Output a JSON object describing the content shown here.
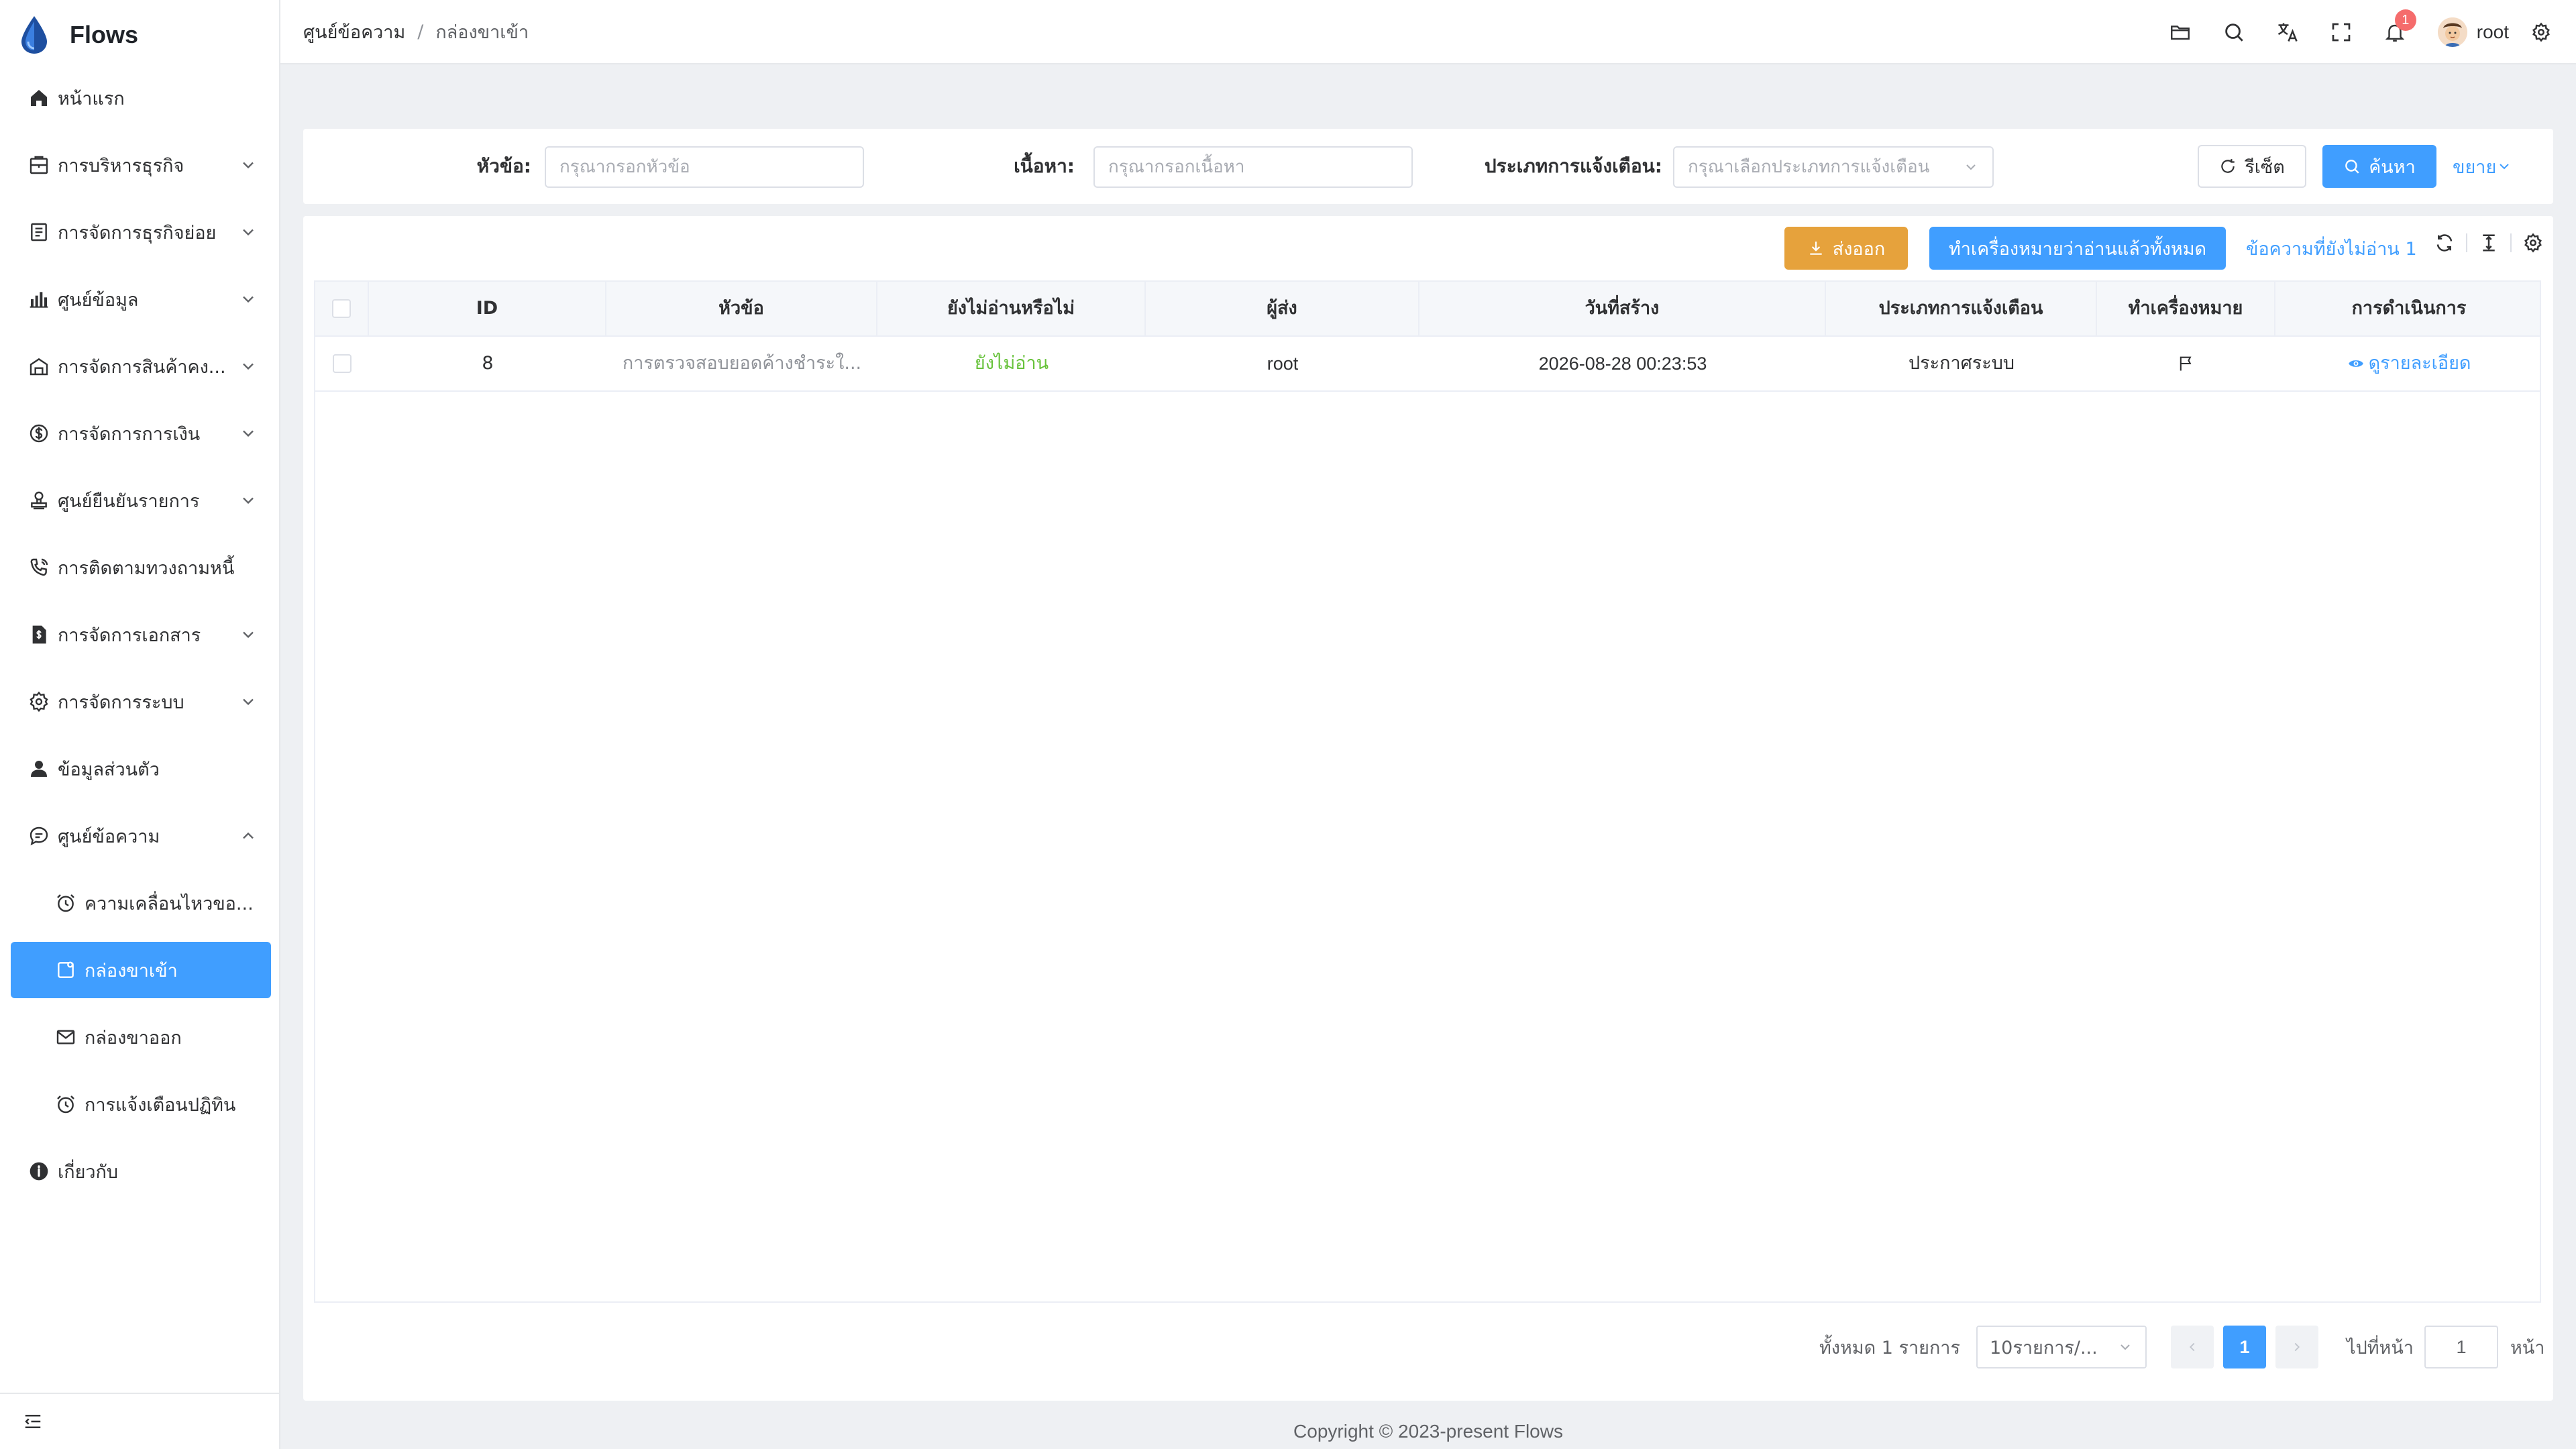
{
  "app": {
    "name": "Flows"
  },
  "sidebar": {
    "items": [
      {
        "label": "หน้าแรก",
        "icon": "home-icon",
        "has_arrow": false
      },
      {
        "label": "การบริหารธุรกิจ",
        "icon": "briefcase-icon",
        "has_arrow": true
      },
      {
        "label": "การจัดการธุรกิจย่อย",
        "icon": "document-list-icon",
        "has_arrow": true
      },
      {
        "label": "ศูนย์ข้อมูล",
        "icon": "bar-chart-icon",
        "has_arrow": true
      },
      {
        "label": "การจัดการสินค้าคง...",
        "icon": "warehouse-icon",
        "has_arrow": true
      },
      {
        "label": "การจัดการการเงิน",
        "icon": "money-icon",
        "has_arrow": true
      },
      {
        "label": "ศูนย์ยืนยันรายการ",
        "icon": "stamp-icon",
        "has_arrow": true
      },
      {
        "label": "การติดตามทวงถามหนี้",
        "icon": "phone-call-icon",
        "has_arrow": false
      },
      {
        "label": "การจัดการเอกสาร",
        "icon": "file-dollar-icon",
        "has_arrow": true
      },
      {
        "label": "การจัดการระบบ",
        "icon": "gear-icon",
        "has_arrow": true
      },
      {
        "label": "ข้อมูลส่วนตัว",
        "icon": "user-icon",
        "has_arrow": false
      },
      {
        "label": "ศูนย์ข้อความ",
        "icon": "chat-icon",
        "has_arrow": true,
        "expanded": true
      }
    ],
    "sub_items": [
      {
        "label": "ความเคลื่อนไหวขอ...",
        "icon": "alarm-clock-icon"
      },
      {
        "label": "กล่องขาเข้า",
        "icon": "inbox-icon",
        "active": true
      },
      {
        "label": "กล่องขาออก",
        "icon": "envelope-icon"
      },
      {
        "label": "การแจ้งเตือนปฏิทิน",
        "icon": "alarm-clock-icon"
      }
    ],
    "about": {
      "label": "เกี่ยวกับ",
      "icon": "info-icon"
    }
  },
  "header": {
    "breadcrumb": [
      "ศูนย์ข้อความ",
      "กล่องขาเข้า"
    ],
    "notification_count": "1",
    "user_name": "root"
  },
  "search": {
    "title_label": "หัวข้อ:",
    "title_placeholder": "กรุณากรอกหัวข้อ",
    "content_label": "เนื้อหา:",
    "content_placeholder": "กรุณากรอกเนื้อหา",
    "type_label": "ประเภทการแจ้งเตือน:",
    "type_placeholder": "กรุณาเลือกประเภทการแจ้งเตือน",
    "reset_label": "รีเซ็ต",
    "search_label": "ค้นหา",
    "expand_label": "ขยาย"
  },
  "toolbar": {
    "export_label": "ส่งออก",
    "mark_all_read_label": "ทำเครื่องหมายว่าอ่านแล้วทั้งหมด",
    "unread_label": "ข้อความที่ยังไม่อ่าน 1"
  },
  "table": {
    "columns": [
      "ID",
      "หัวข้อ",
      "ยังไม่อ่านหรือไม่",
      "ผู้ส่ง",
      "วันที่สร้าง",
      "ประเภทการแจ้งเตือน",
      "ทำเครื่องหมาย",
      "การดำเนินการ"
    ],
    "rows": [
      {
        "id": "8",
        "title": "การตรวจสอบยอดค้างชำระใ...",
        "unread": "ยังไม่อ่าน",
        "sender": "root",
        "created": "2026-08-28 00:23:53",
        "type": "ประกาศระบบ",
        "action": "ดูรายละเอียด"
      }
    ]
  },
  "pagination": {
    "total_label": "ทั้งหมด 1 รายการ",
    "page_size": "10รายการ/...",
    "current_page": "1",
    "goto_label": "ไปที่หน้า",
    "goto_value": "1",
    "page_suffix": "หน้า"
  },
  "footer": {
    "text": "Copyright © 2023-present Flows"
  },
  "colors": {
    "primary": "#409eff",
    "warning": "#e6a23c",
    "success": "#67c23a",
    "danger": "#f56c6c"
  }
}
